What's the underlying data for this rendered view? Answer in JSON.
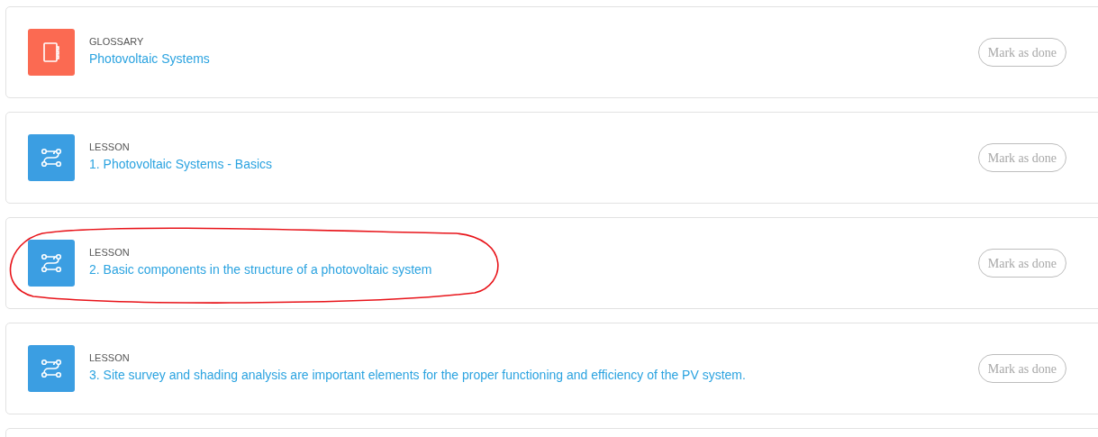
{
  "items": [
    {
      "kind": "glossary",
      "type_label": "GLOSSARY",
      "title": "Photovoltaic Systems",
      "button": "Mark as done",
      "highlighted": false
    },
    {
      "kind": "lesson",
      "type_label": "LESSON",
      "title": "1. Photovoltaic Systems - Basics",
      "button": "Mark as done",
      "highlighted": false
    },
    {
      "kind": "lesson",
      "type_label": "LESSON",
      "title": "2. Basic components in the structure of a photovoltaic system",
      "button": "Mark as done",
      "highlighted": true
    },
    {
      "kind": "lesson",
      "type_label": "LESSON",
      "title": "3. Site survey and shading analysis are important elements for the proper functioning and efficiency of the PV system.",
      "button": "Mark as done",
      "highlighted": false
    }
  ]
}
